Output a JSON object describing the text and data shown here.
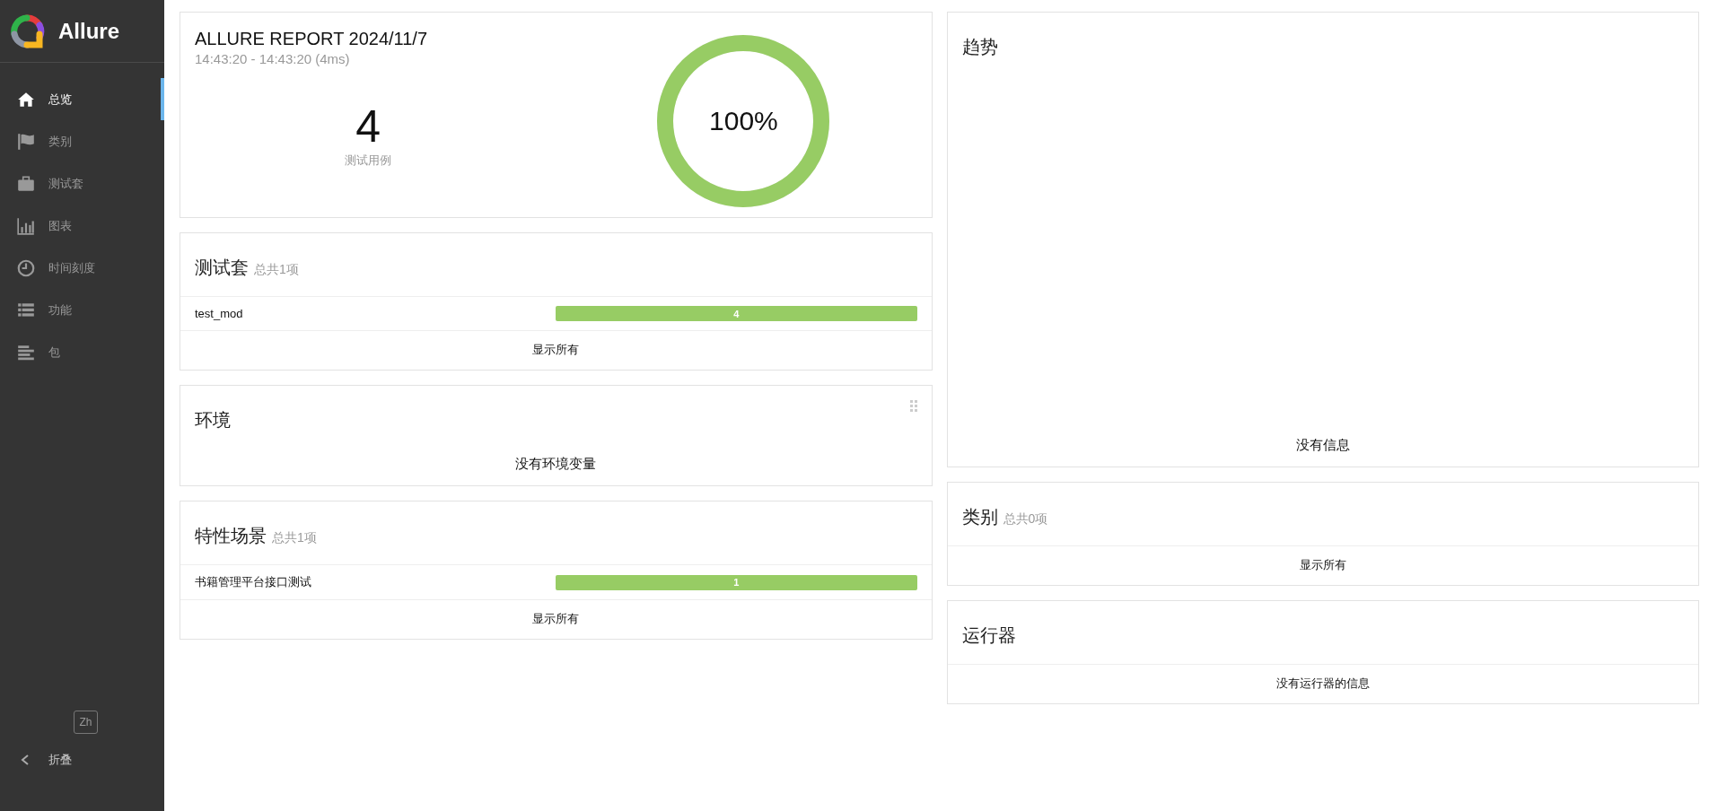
{
  "sidebar": {
    "logo": "Allure",
    "items": [
      {
        "label": "总览",
        "selected": true
      },
      {
        "label": "类别",
        "selected": false
      },
      {
        "label": "测试套",
        "selected": false
      },
      {
        "label": "图表",
        "selected": false
      },
      {
        "label": "时间刻度",
        "selected": false
      },
      {
        "label": "功能",
        "selected": false
      },
      {
        "label": "包",
        "selected": false
      }
    ],
    "language": "Zh",
    "collapse": "折叠"
  },
  "summary": {
    "title": "ALLURE REPORT 2024/11/7",
    "time": "14:43:20 - 14:43:20 (4ms)",
    "count": "4",
    "count_label": "测试用例",
    "rate": "100%",
    "level": 1
  },
  "left": [
    {
      "kind": "bars",
      "title": "测试套",
      "subtitle": "总共1项",
      "rows": [
        {
          "name": "test_mod",
          "bar": "4",
          "level": 1
        }
      ],
      "footer": "显示所有"
    },
    {
      "kind": "message",
      "title": "环境",
      "grip": true,
      "message": "没有环境变量"
    },
    {
      "kind": "bars",
      "title": "特性场景",
      "subtitle": "总共1项",
      "rows": [
        {
          "name": "书籍管理平台接口测试",
          "bar": "1",
          "level": 1
        }
      ],
      "footer": "显示所有"
    }
  ],
  "right": [
    {
      "kind": "trend",
      "title": "趋势",
      "message": "没有信息"
    },
    {
      "kind": "bars",
      "title": "类别",
      "subtitle": "总共0项",
      "footer": "显示所有"
    },
    {
      "kind": "footer",
      "title": "运行器",
      "footer": "没有运行器的信息"
    }
  ]
}
